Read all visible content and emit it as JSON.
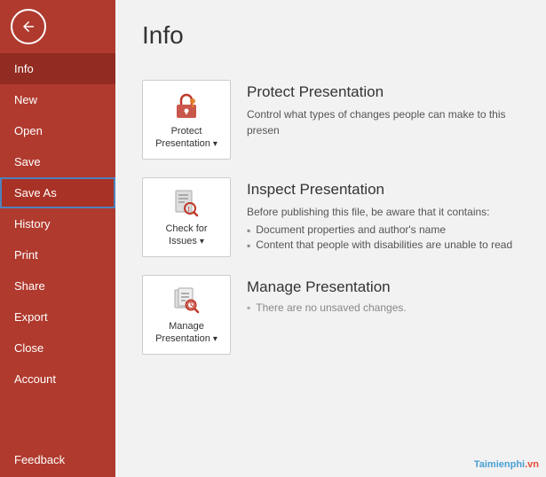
{
  "sidebar": {
    "back_label": "←",
    "items": [
      {
        "id": "info",
        "label": "Info",
        "active": true
      },
      {
        "id": "new",
        "label": "New"
      },
      {
        "id": "open",
        "label": "Open"
      },
      {
        "id": "save",
        "label": "Save"
      },
      {
        "id": "save-as",
        "label": "Save As",
        "highlight": true
      },
      {
        "id": "history",
        "label": "History"
      },
      {
        "id": "print",
        "label": "Print"
      },
      {
        "id": "share",
        "label": "Share"
      },
      {
        "id": "export",
        "label": "Export"
      },
      {
        "id": "close",
        "label": "Close"
      },
      {
        "id": "account",
        "label": "Account"
      }
    ],
    "feedback_label": "Feedback"
  },
  "main": {
    "title": "Info",
    "cards": [
      {
        "id": "protect",
        "icon_label": "Protect\nPresentation",
        "title": "Protect Presentation",
        "desc": "Control what types of changes people can make to this presen"
      },
      {
        "id": "inspect",
        "icon_label": "Check for\nIssues",
        "title": "Inspect Presentation",
        "desc": "Before publishing this file, be aware that it contains:",
        "list": [
          "Document properties and author's name",
          "Content that people with disabilities are unable to read"
        ]
      },
      {
        "id": "manage",
        "icon_label": "Manage\nPresentation",
        "title": "Manage Presentation",
        "nosave": "There are no unsaved changes."
      }
    ]
  },
  "watermark": {
    "text": "Taimienphi",
    "suffix": ".vn"
  }
}
